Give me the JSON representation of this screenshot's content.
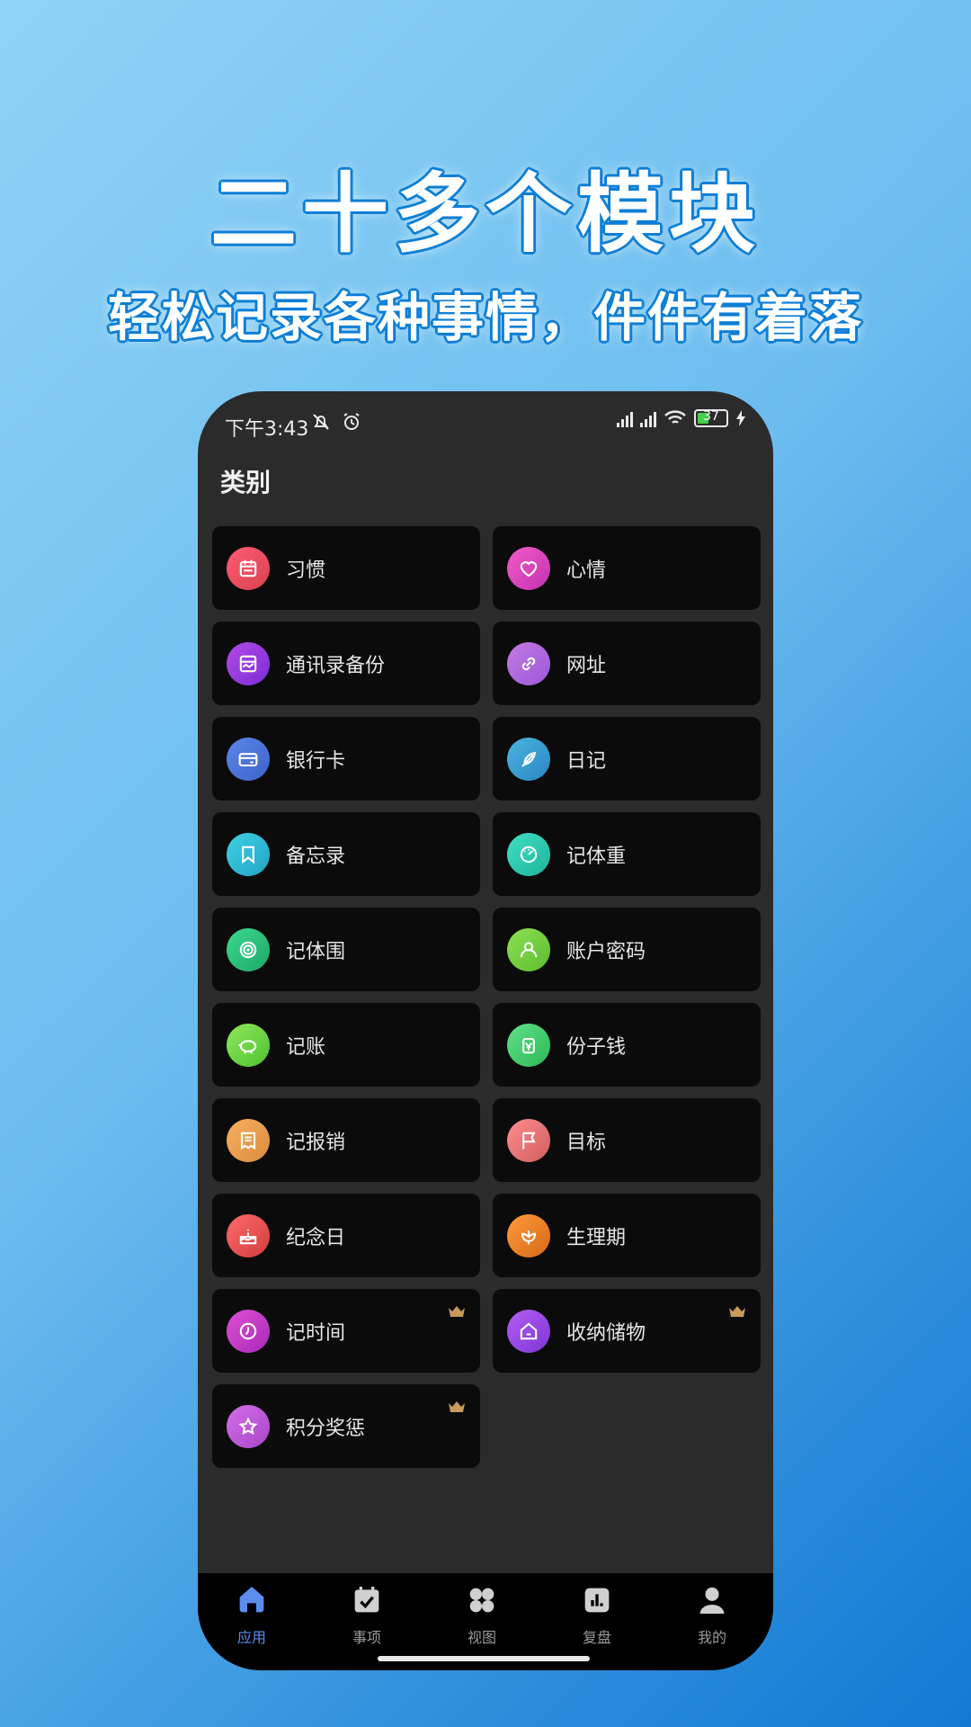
{
  "promo": {
    "title": "二十多个模块",
    "subtitle": "轻松记录各种事情，件件有着落"
  },
  "status": {
    "time": "下午3:43",
    "battery": "37"
  },
  "page": {
    "title": "类别"
  },
  "modules": [
    {
      "label": "习惯",
      "icon": "calendar-icon",
      "color1": "#ff5a74",
      "color2": "#d8434f"
    },
    {
      "label": "心情",
      "icon": "heart-icon",
      "color1": "#f45bc6",
      "color2": "#c232b0"
    },
    {
      "label": "通讯录备份",
      "icon": "contacts-icon",
      "color1": "#b24ae6",
      "color2": "#7b2ed6"
    },
    {
      "label": "网址",
      "icon": "link-icon",
      "color1": "#c47ae0",
      "color2": "#9b58d8"
    },
    {
      "label": "银行卡",
      "icon": "card-icon",
      "color1": "#5b86e8",
      "color2": "#3d63c9"
    },
    {
      "label": "日记",
      "icon": "feather-icon",
      "color1": "#4bb4e0",
      "color2": "#2b86c3"
    },
    {
      "label": "备忘录",
      "icon": "bookmark-icon",
      "color1": "#3ed1e2",
      "color2": "#22a5c6"
    },
    {
      "label": "记体重",
      "icon": "scale-icon",
      "color1": "#3ee0c5",
      "color2": "#1fb39b"
    },
    {
      "label": "记体围",
      "icon": "target-icon",
      "color1": "#3cd98f",
      "color2": "#1ca868"
    },
    {
      "label": "账户密码",
      "icon": "user-icon",
      "color1": "#8ee055",
      "color2": "#5cbd2e"
    },
    {
      "label": "记账",
      "icon": "piggybank-icon",
      "color1": "#8ee85a",
      "color2": "#4fc232"
    },
    {
      "label": "份子钱",
      "icon": "money-jar-icon",
      "color1": "#63e08a",
      "color2": "#2bb954"
    },
    {
      "label": "记报销",
      "icon": "receipt-icon",
      "color1": "#f7b060",
      "color2": "#d98c3c"
    },
    {
      "label": "目标",
      "icon": "flag-icon",
      "color1": "#ff8d8d",
      "color2": "#d15e5e"
    },
    {
      "label": "纪念日",
      "icon": "cake-icon",
      "color1": "#ff6b6b",
      "color2": "#d13c3c"
    },
    {
      "label": "生理期",
      "icon": "flower-icon",
      "color1": "#ff9a3c",
      "color2": "#d66a16"
    },
    {
      "label": "记时间",
      "icon": "clock-icon",
      "color1": "#e04fd3",
      "color2": "#a72bb8",
      "premium": true
    },
    {
      "label": "收纳储物",
      "icon": "home-box-icon",
      "color1": "#b35ef2",
      "color2": "#7e35d6",
      "premium": true
    },
    {
      "label": "积分奖惩",
      "icon": "star-icon",
      "color1": "#d46ee8",
      "color2": "#a746c9",
      "premium": true
    }
  ],
  "tabs": [
    {
      "label": "应用",
      "icon": "house-icon",
      "active": true
    },
    {
      "label": "事项",
      "icon": "calendar-check-icon"
    },
    {
      "label": "视图",
      "icon": "grid-icon"
    },
    {
      "label": "复盘",
      "icon": "chart-icon"
    },
    {
      "label": "我的",
      "icon": "person-icon"
    }
  ],
  "colors": {
    "accent": "#5b8def",
    "crown": "#c89a5a"
  }
}
